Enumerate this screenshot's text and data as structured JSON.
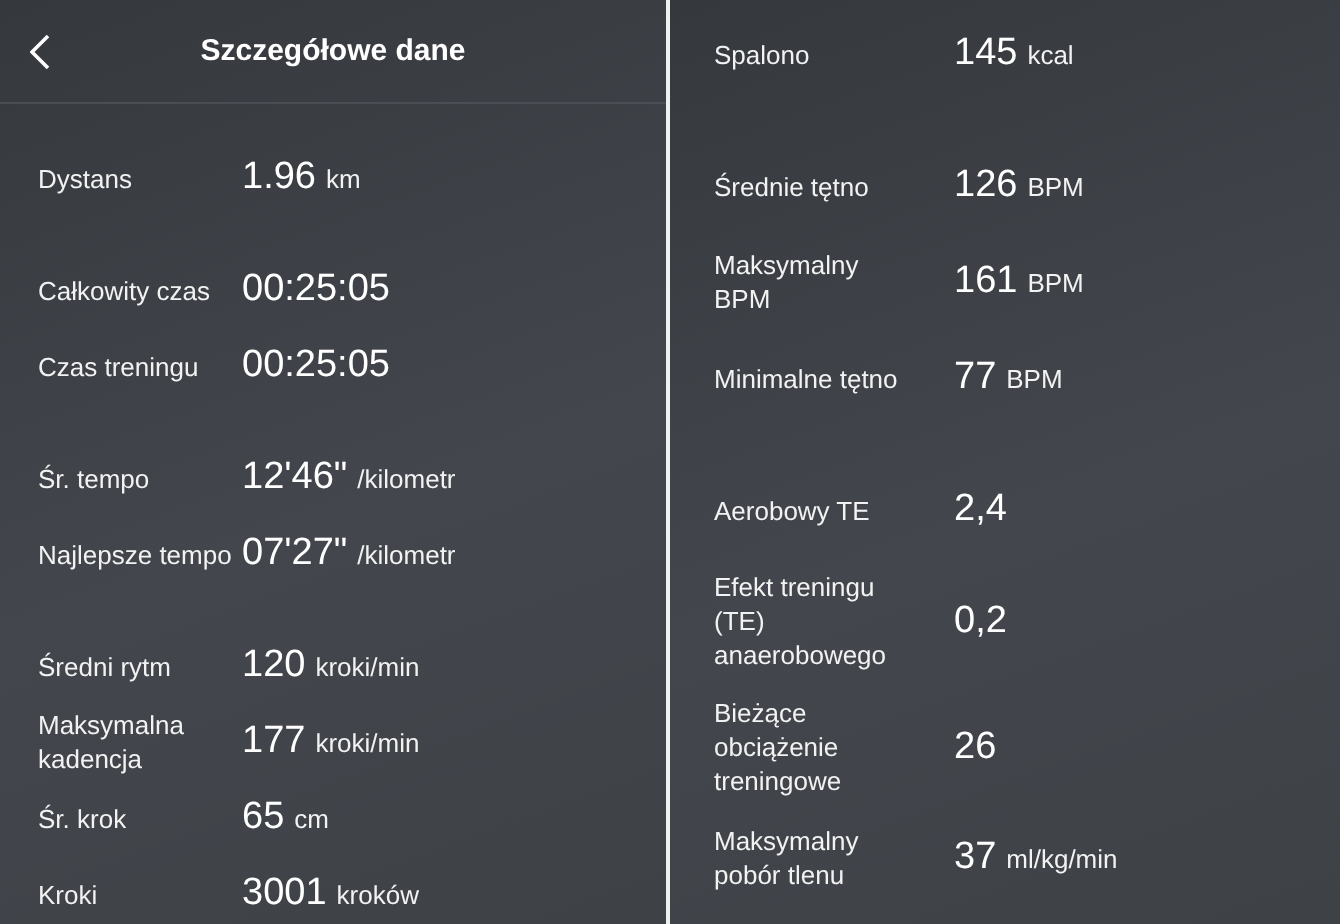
{
  "header": {
    "title": "Szczegółowe dane"
  },
  "left_panel": {
    "groups": [
      [
        {
          "label": "Dystans",
          "value": "1.96",
          "unit": "km"
        }
      ],
      [
        {
          "label": "Całkowity czas",
          "value": "00:25:05"
        },
        {
          "label": "Czas treningu",
          "value": "00:25:05"
        }
      ],
      [
        {
          "label": "Śr. tempo",
          "value": "12'46\"",
          "unit": "/kilometr"
        },
        {
          "label": "Najlepsze tempo",
          "value": "07'27\"",
          "unit": "/kilometr"
        }
      ],
      [
        {
          "label": "Średni rytm",
          "value": "120",
          "unit": "kroki/min"
        },
        {
          "label": "Maksymalna kadencja",
          "value": "177",
          "unit": "kroki/min"
        },
        {
          "label": "Śr. krok",
          "value": "65",
          "unit": "cm"
        },
        {
          "label": "Kroki",
          "value": "3001",
          "unit": "kroków"
        }
      ]
    ]
  },
  "right_panel": {
    "groups": [
      [
        {
          "label": "Spalono",
          "value": "145",
          "unit": "kcal"
        }
      ],
      [
        {
          "label": "Średnie tętno",
          "value": "126",
          "unit": "BPM"
        },
        {
          "label": "Maksymalny BPM",
          "value": "161",
          "unit": "BPM"
        },
        {
          "label": "Minimalne tętno",
          "value": "77",
          "unit": "BPM"
        }
      ],
      [
        {
          "label": "Aerobowy TE",
          "value": "2,4"
        },
        {
          "label": "Efekt treningu (TE) anaerobowego",
          "value": "0,2"
        },
        {
          "label": "Bieżące obciążenie treningowe",
          "value": "26"
        },
        {
          "label": "Maksymalny pobór tlenu",
          "value": "37",
          "unit": "ml/kg/min"
        }
      ]
    ]
  }
}
